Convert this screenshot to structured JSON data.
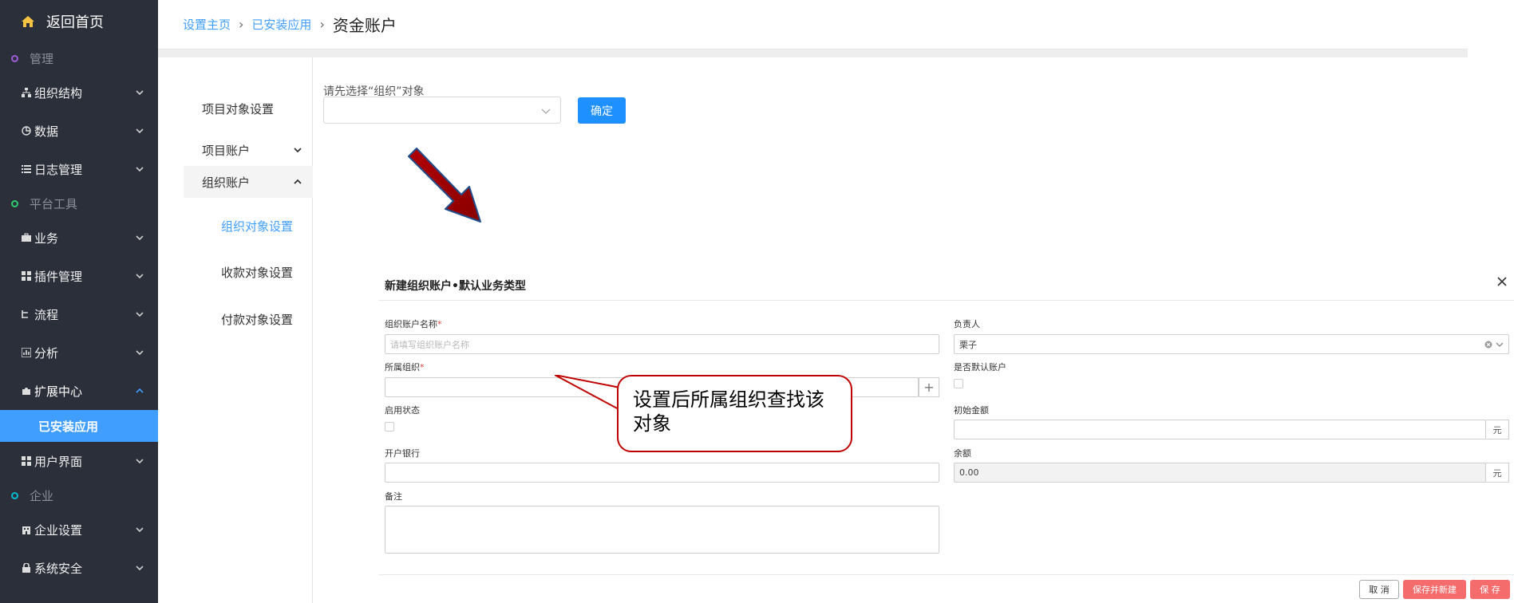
{
  "sidebar": {
    "home_label": "返回首页",
    "group_manage": "管理",
    "group_platform": "平台工具",
    "group_enterprise": "企业",
    "items": [
      {
        "label": "组织结构"
      },
      {
        "label": "数据"
      },
      {
        "label": "日志管理"
      },
      {
        "label": "业务"
      },
      {
        "label": "插件管理"
      },
      {
        "label": "流程"
      },
      {
        "label": "分析"
      },
      {
        "label": "扩展中心"
      },
      {
        "label": "已安装应用"
      },
      {
        "label": "用户界面"
      },
      {
        "label": "企业设置"
      },
      {
        "label": "系统安全"
      }
    ],
    "colors": {
      "bg": "#2b2f3a",
      "active": "#409eff"
    }
  },
  "breadcrumb": {
    "home": "设置主页",
    "installed": "已安装应用",
    "current": "资金账户"
  },
  "submenu": {
    "project_object": "项目对象设置",
    "project_account": "项目账户",
    "org_account": "组织账户",
    "org_object": "组织对象设置",
    "receive_object": "收款对象设置",
    "pay_object": "付款对象设置"
  },
  "filter": {
    "label": "请先选择“组织”对象",
    "confirm_label": "确定"
  },
  "dialog": {
    "title": "新建组织账户•默认业务类型",
    "account_name_label": "组织账户名称",
    "account_name_placeholder": "请填写组织账户名称",
    "owner_label": "负责人",
    "owner_value": "栗子",
    "org_label": "所属组织",
    "default_account_label": "是否默认账户",
    "enabled_label": "启用状态",
    "initial_amount_label": "初始金额",
    "bank_label": "开户银行",
    "balance_label": "余额",
    "balance_value": "0.00",
    "unit": "元",
    "remark_label": "备注",
    "required_mark": "*",
    "plus": "+",
    "cancel_label": "取 消",
    "save_new_label": "保存并新建",
    "save_label": "保 存"
  },
  "callout": {
    "text": "设置后所属组织查找该对象"
  },
  "colors": {
    "primary": "#409eff",
    "danger": "#f56c6c",
    "annotation": "#c00000"
  }
}
